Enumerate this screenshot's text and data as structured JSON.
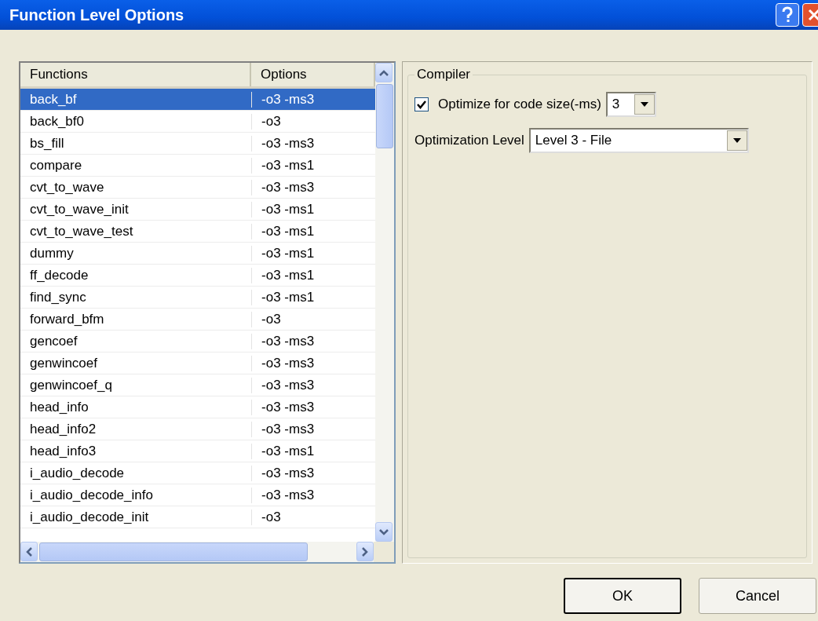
{
  "window": {
    "title": "Function Level Options"
  },
  "table": {
    "columns": [
      "Functions",
      "Options"
    ],
    "rows": [
      {
        "function": "back_bf",
        "options": "-o3 -ms3",
        "selected": true
      },
      {
        "function": "back_bf0",
        "options": "-o3",
        "selected": false
      },
      {
        "function": "bs_fill",
        "options": "-o3 -ms3",
        "selected": false
      },
      {
        "function": "compare",
        "options": "-o3 -ms1",
        "selected": false
      },
      {
        "function": "cvt_to_wave",
        "options": "-o3 -ms3",
        "selected": false
      },
      {
        "function": "cvt_to_wave_init",
        "options": "-o3 -ms1",
        "selected": false
      },
      {
        "function": "cvt_to_wave_test",
        "options": "-o3 -ms1",
        "selected": false
      },
      {
        "function": "dummy",
        "options": "-o3 -ms1",
        "selected": false
      },
      {
        "function": "ff_decode",
        "options": "-o3 -ms1",
        "selected": false
      },
      {
        "function": "find_sync",
        "options": "-o3 -ms1",
        "selected": false
      },
      {
        "function": "forward_bfm",
        "options": "-o3",
        "selected": false
      },
      {
        "function": "gencoef",
        "options": "-o3 -ms3",
        "selected": false
      },
      {
        "function": "genwincoef",
        "options": "-o3 -ms3",
        "selected": false
      },
      {
        "function": "genwincoef_q",
        "options": "-o3 -ms3",
        "selected": false
      },
      {
        "function": "head_info",
        "options": "-o3 -ms3",
        "selected": false
      },
      {
        "function": "head_info2",
        "options": "-o3 -ms3",
        "selected": false
      },
      {
        "function": "head_info3",
        "options": "-o3 -ms1",
        "selected": false
      },
      {
        "function": "i_audio_decode",
        "options": "-o3 -ms3",
        "selected": false
      },
      {
        "function": "i_audio_decode_info",
        "options": "-o3 -ms3",
        "selected": false
      },
      {
        "function": "i_audio_decode_init",
        "options": "-o3",
        "selected": false
      }
    ]
  },
  "compiler": {
    "title": "Compiler",
    "optimize_size": {
      "label": "Optimize for code size(-ms)",
      "checked": true,
      "value": "3"
    },
    "optimization_level": {
      "label": "Optimization Level",
      "value": "Level 3 - File"
    }
  },
  "buttons": [
    {
      "label": "OK",
      "default": true
    },
    {
      "label": "Cancel",
      "default": false
    }
  ]
}
